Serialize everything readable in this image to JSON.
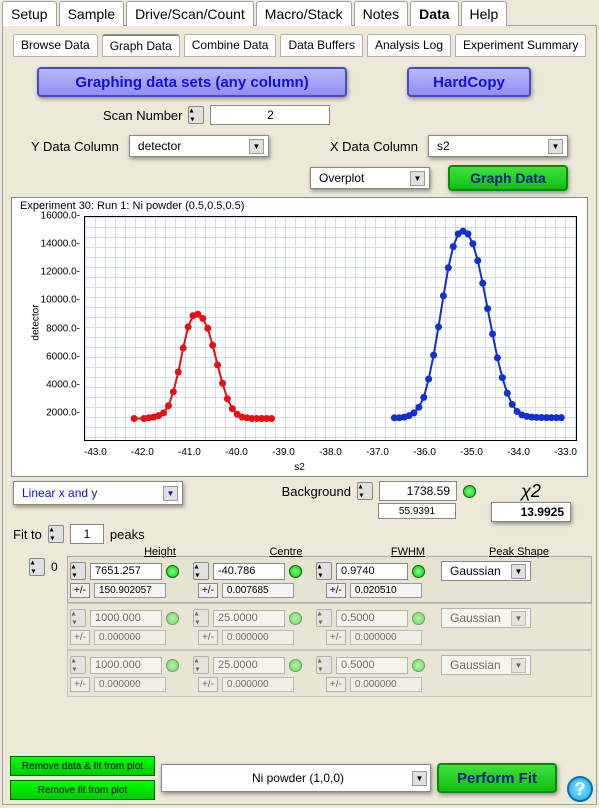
{
  "tabs": {
    "top": [
      "Setup",
      "Sample",
      "Drive/Scan/Count",
      "Macro/Stack",
      "Notes",
      "Data",
      "Help"
    ],
    "active": "Data",
    "sub": [
      "Browse Data",
      "Graph Data",
      "Combine Data",
      "Data Buffers",
      "Analysis Log",
      "Experiment Summary"
    ],
    "subactive": "Graph Data"
  },
  "buttons": {
    "graphsets": "Graphing data sets (any column)",
    "hardcopy": "HardCopy",
    "graphdata": "Graph Data",
    "performfit": "Perform Fit",
    "remove1": "Remove data & fit from plot",
    "remove2": "Remove fit from plot"
  },
  "labels": {
    "scannum": "Scan Number",
    "ydata": "Y Data Column",
    "xdata": "X Data Column",
    "bg": "Background",
    "fitto": "Fit to",
    "peaks": "peaks",
    "height": "Height",
    "centre": "Centre",
    "fwhm": "FWHM",
    "shape": "Peak Shape",
    "pm": "+/-"
  },
  "values": {
    "scannum": "2",
    "ycol": "detector",
    "xcol": "s2",
    "plotmode": "Overplot",
    "scale": "Linear x and y",
    "fitpeaks": "1",
    "bg": "1738.59",
    "bgerr": "55.9391",
    "chi2": "13.9925",
    "chi2label": "χ2",
    "peakidx": "0",
    "datasel": "Ni powder (1,0,0)"
  },
  "peaks": [
    {
      "h": "7651.257",
      "herr": "150.902057",
      "c": "-40.786",
      "cerr": "0.007685",
      "f": "0.9740",
      "ferr": "0.020510",
      "shape": "Gaussian",
      "enabled": true
    },
    {
      "h": "1000.000",
      "herr": "0.000000",
      "c": "25.0000",
      "cerr": "0.000000",
      "f": "0.5000",
      "ferr": "0.000000",
      "shape": "Gaussian",
      "enabled": false
    },
    {
      "h": "1000.000",
      "herr": "0.000000",
      "c": "25.0000",
      "cerr": "0.000000",
      "f": "0.5000",
      "ferr": "0.000000",
      "shape": "Gaussian",
      "enabled": false
    }
  ],
  "chart_data": {
    "type": "scatter+line",
    "title": "Experiment  30: Run 1:  Ni powder (0.5,0.5,0.5)",
    "xlabel": "s2",
    "ylabel": "detector",
    "xlim": [
      -43.0,
      -33.0
    ],
    "ylim": [
      0,
      16000
    ],
    "xticks": [
      -43.0,
      -42.0,
      -41.0,
      -40.0,
      -39.0,
      -38.0,
      -37.0,
      -36.0,
      -35.0,
      -34.0,
      -33.0
    ],
    "yticks": [
      2000,
      4000,
      6000,
      8000,
      10000,
      12000,
      14000,
      16000
    ],
    "series": [
      {
        "name": "red",
        "color": "#e81010",
        "x": [
          -42.0,
          -41.8,
          -41.7,
          -41.6,
          -41.5,
          -41.4,
          -41.3,
          -41.2,
          -41.1,
          -41.0,
          -40.9,
          -40.8,
          -40.7,
          -40.6,
          -40.5,
          -40.4,
          -40.3,
          -40.2,
          -40.1,
          -40.0,
          -39.9,
          -39.8,
          -39.7,
          -39.6,
          -39.5,
          -39.4,
          -39.3,
          -39.2
        ],
        "y": [
          1700,
          1700,
          1750,
          1800,
          1900,
          2100,
          2600,
          3600,
          5000,
          6700,
          8200,
          9000,
          9100,
          8800,
          8100,
          6900,
          5500,
          4200,
          3100,
          2400,
          2000,
          1800,
          1750,
          1700,
          1700,
          1700,
          1700,
          1700
        ]
      },
      {
        "name": "blue",
        "color": "#1030d0",
        "x": [
          -36.7,
          -36.6,
          -36.5,
          -36.4,
          -36.3,
          -36.2,
          -36.1,
          -36.0,
          -35.9,
          -35.8,
          -35.7,
          -35.6,
          -35.5,
          -35.4,
          -35.3,
          -35.2,
          -35.1,
          -35.0,
          -34.9,
          -34.8,
          -34.7,
          -34.6,
          -34.5,
          -34.4,
          -34.3,
          -34.2,
          -34.1,
          -34.0,
          -33.9,
          -33.8,
          -33.7,
          -33.6,
          -33.5,
          -33.4,
          -33.3
        ],
        "y": [
          1750,
          1750,
          1800,
          1900,
          2100,
          2500,
          3200,
          4500,
          6200,
          8200,
          10400,
          12400,
          13900,
          14800,
          15000,
          14800,
          14100,
          12900,
          11300,
          9500,
          7700,
          6000,
          4600,
          3500,
          2700,
          2200,
          1950,
          1850,
          1800,
          1780,
          1770,
          1760,
          1760,
          1760,
          1760
        ]
      }
    ]
  }
}
